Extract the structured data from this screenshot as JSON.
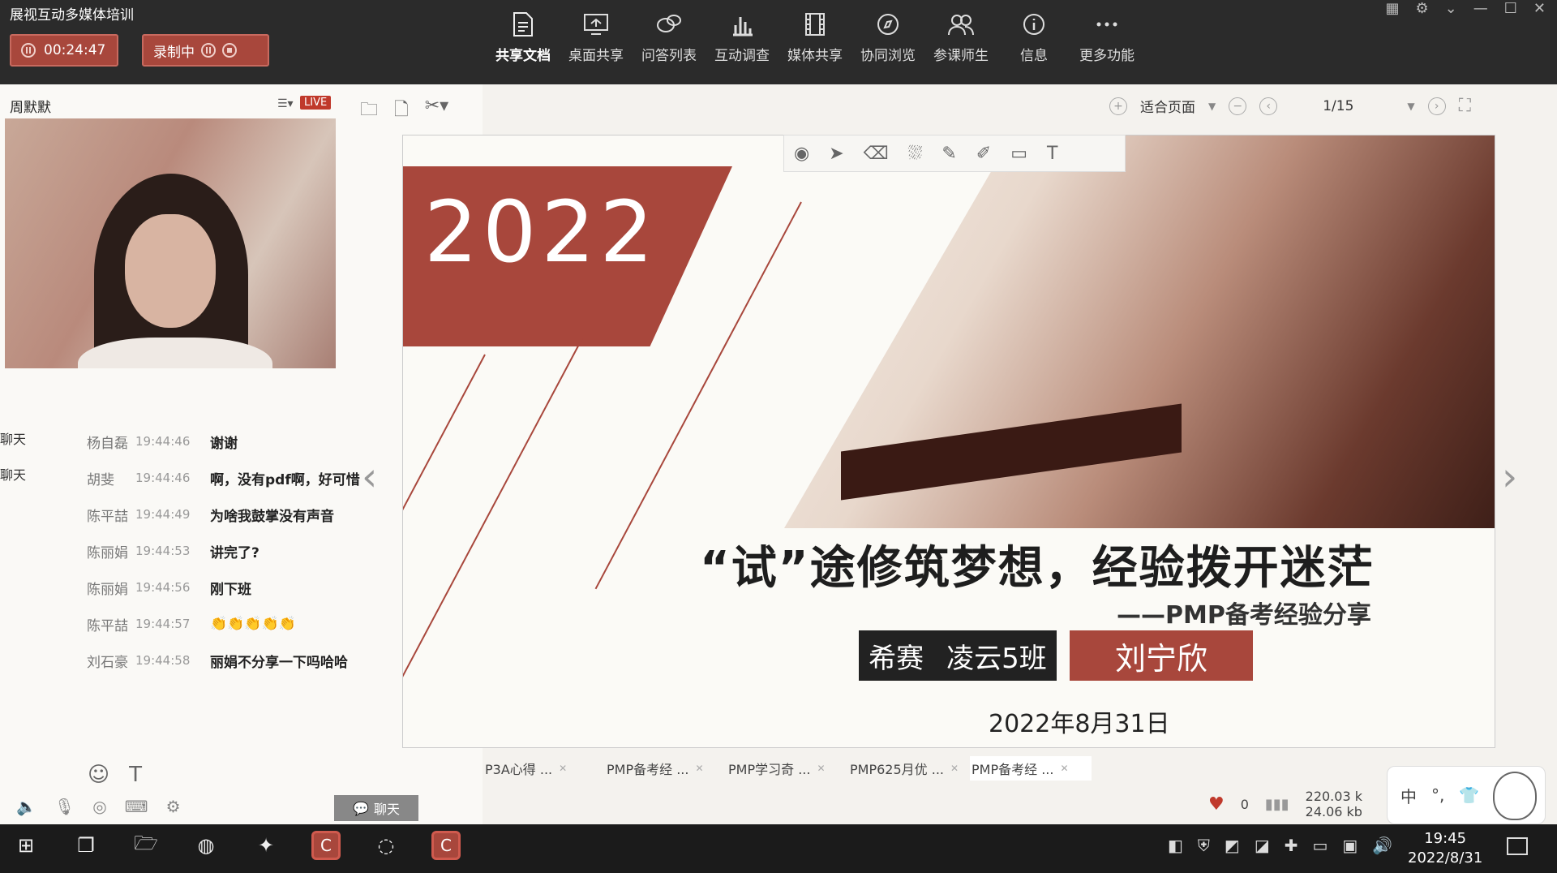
{
  "app": {
    "title": "展视互动多媒体培训"
  },
  "session": {
    "timer": "00:24:47",
    "recording_label": "录制中"
  },
  "toolbar": {
    "items": [
      {
        "label": "共享文档",
        "icon": "document-icon"
      },
      {
        "label": "桌面共享",
        "icon": "screen-share-icon"
      },
      {
        "label": "问答列表",
        "icon": "qa-icon"
      },
      {
        "label": "互动调查",
        "icon": "bar-chart-icon"
      },
      {
        "label": "媒体共享",
        "icon": "film-icon"
      },
      {
        "label": "协同浏览",
        "icon": "compass-icon"
      },
      {
        "label": "参课师生",
        "icon": "people-icon"
      },
      {
        "label": "信息",
        "icon": "info-icon"
      },
      {
        "label": "更多功能",
        "icon": "more-icon"
      }
    ]
  },
  "presenter": {
    "name": "周默默",
    "live_badge": "LIVE"
  },
  "chat": {
    "tabs": [
      "聊天",
      "聊天"
    ],
    "messages": [
      {
        "user": "杨自磊",
        "time": "19:44:46",
        "text": "谢谢"
      },
      {
        "user": "胡斐",
        "time": "19:44:46",
        "text": "啊，没有pdf啊，好可惜"
      },
      {
        "user": "陈平喆",
        "time": "19:44:49",
        "text": "为啥我鼓掌没有声音"
      },
      {
        "user": "陈丽娟",
        "time": "19:44:53",
        "text": "讲完了?"
      },
      {
        "user": "陈丽娟",
        "time": "19:44:56",
        "text": "刚下班"
      },
      {
        "user": "陈平喆",
        "time": "19:44:57",
        "text": "👏👏👏👏👏"
      },
      {
        "user": "刘石豪",
        "time": "19:44:58",
        "text": "丽娟不分享一下吗哈哈"
      }
    ],
    "chat_button": "聊天"
  },
  "doc_view": {
    "fit_label": "适合页面",
    "page_indicator": "1/15"
  },
  "slide": {
    "year": "2022",
    "headline": "“试”途修筑梦想，经验拨开迷茫",
    "subline": "——PMP备考经验分享",
    "class_name_1": "希赛",
    "class_name_2": "凌云5班",
    "presenter": "刘宁欣",
    "date": "2022年8月31日"
  },
  "doc_tabs": [
    {
      "label": "P3A心得 ..."
    },
    {
      "label": "PMP备考经 ..."
    },
    {
      "label": "PMP学习奇 ..."
    },
    {
      "label": "PMP625月优 ..."
    },
    {
      "label": "PMP备考经 ..."
    }
  ],
  "stats": {
    "likes": "0",
    "up_speed": "220.03 k",
    "down_speed": "24.06 kb"
  },
  "ime": {
    "lang": "中"
  },
  "taskbar": {
    "time": "19:45",
    "date": "2022/8/31"
  },
  "colors": {
    "brand": "#a8473c",
    "topbar": "#2b2b2b",
    "slide_bg": "#fbfaf6"
  }
}
